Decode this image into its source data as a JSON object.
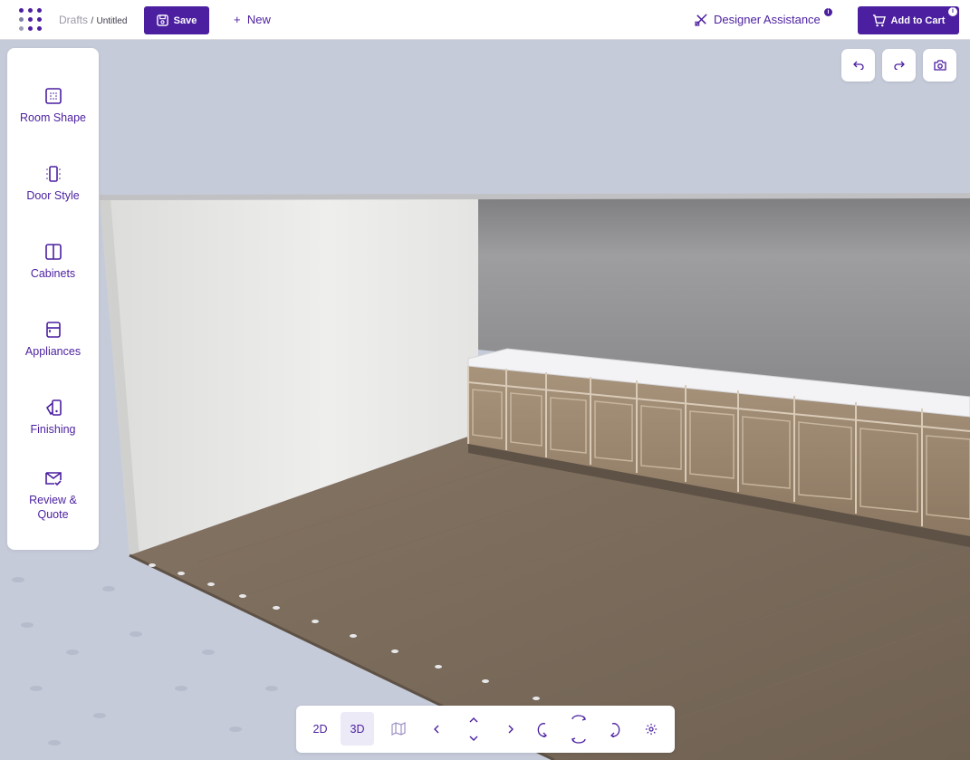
{
  "header": {
    "breadcrumb_root": "Drafts",
    "breadcrumb_separator": "/",
    "breadcrumb_current": "Untitled",
    "save_label": "Save",
    "new_label": "New",
    "designer_label": "Designer Assistance",
    "designer_info": "i",
    "cart_label": "Add to Cart",
    "cart_info": "i"
  },
  "sidebar": {
    "items": [
      {
        "label": "Room Shape",
        "icon": "room-shape-icon"
      },
      {
        "label": "Door Style",
        "icon": "door-style-icon"
      },
      {
        "label": "Cabinets",
        "icon": "cabinets-icon"
      },
      {
        "label": "Appliances",
        "icon": "appliances-icon"
      },
      {
        "label": "Finishing",
        "icon": "finishing-icon"
      },
      {
        "label": "Review &",
        "label2": "Quote",
        "icon": "review-quote-icon"
      }
    ]
  },
  "corner_controls": [
    "undo-icon",
    "redo-icon",
    "camera-icon"
  ],
  "view_controls": {
    "mode_2d": "2D",
    "mode_3d": "3D",
    "active_mode": "3D",
    "icons": [
      "map-icon",
      "rotate-left-icon",
      "tilt-up-icon",
      "tilt-down-icon",
      "rotate-right-icon",
      "orbit-left-icon",
      "orbit-top-icon",
      "orbit-bottom-icon",
      "orbit-right-icon",
      "settings-icon"
    ]
  },
  "colors": {
    "brand": "#4b1fa0",
    "background": "#c5cad9",
    "floor": "#8a7a68",
    "cabinet": "#9f8a72",
    "countertop": "#f2f2f4"
  }
}
